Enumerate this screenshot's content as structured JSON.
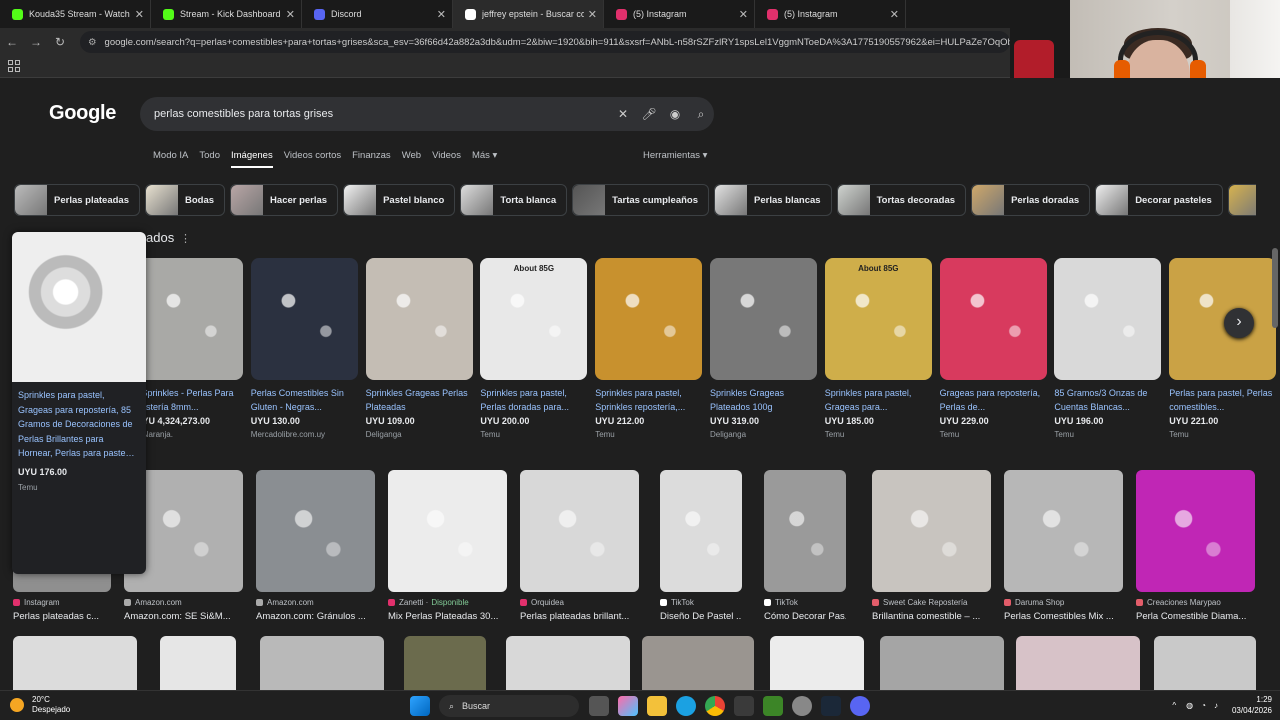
{
  "tabs": [
    {
      "title": "Kouda35 Stream - Watch Live",
      "color": "#53fc18"
    },
    {
      "title": "Stream - Kick Dashboard",
      "color": "#53fc18"
    },
    {
      "title": "Discord",
      "color": "#5865f2"
    },
    {
      "title": "jeffrey epstein - Buscar con G",
      "color": "#ffffff"
    },
    {
      "title": "(5) Instagram",
      "color": "#e1306c"
    },
    {
      "title": "(5) Instagram",
      "color": "#e1306c"
    }
  ],
  "address_url": "google.com/search?q=perlas+comestibles+para+tortas+grises&sca_esv=36f66d42a882a3db&udm=2&biw=1920&bih=911&sxsrf=ANbL-n58rSZFzlRY1spsLel1VggmNToeDA%3A1775190557962&ei=HULPaZe7OqOb5OU",
  "google_logo": "Google",
  "search_query": "perlas comestibles para tortas grises",
  "nav_tabs": [
    "Modo IA",
    "Todo",
    "Imágenes",
    "Videos cortos",
    "Finanzas",
    "Web",
    "Videos",
    "Más ▾"
  ],
  "tools_label": "Herramientas ▾",
  "chips": [
    "Perlas plateadas",
    "Bodas",
    "Hacer perlas",
    "Pastel blanco",
    "Torta blanca",
    "Tartas cumpleaños",
    "Perlas blancas",
    "Tortas decoradas",
    "Perlas doradas",
    "Decorar pasteles",
    "Per"
  ],
  "related_heading": "ados",
  "hover_card": {
    "title": "Sprinkles para pastel, Grageas para repostería, 85 Gramos de Decoraciones de Perlas Brillantes para Hornear, Perlas para paste…",
    "price": "UYU 176.00",
    "source": "Temu"
  },
  "products": [
    {
      "title": "- Sprinkles - Perlas Para postería 8mm...",
      "price": "UYU 4,324,273.00",
      "source": "a Naranja.",
      "bg": "#a9a9a6"
    },
    {
      "title": "Perlas Comestibles Sin Gluten - Negras...",
      "price": "UYU 130.00",
      "source": "Mercadolibre.com.uy",
      "bg": "#2b3140"
    },
    {
      "title": "Sprinkles Grageas Perlas Plateadas",
      "price": "UYU 109.00",
      "source": "Deliganga",
      "bg": "#c4bdb4"
    },
    {
      "title": "Sprinkles para pastel, Perlas doradas para...",
      "price": "UYU 200.00",
      "source": "Temu",
      "bg": "#e8e8e8",
      "label": "About 85G"
    },
    {
      "title": "Sprinkles para pastel, Sprinkles repostería,...",
      "price": "UYU 212.00",
      "source": "Temu",
      "bg": "#c8912e"
    },
    {
      "title": "Sprinkles Grageas Plateados 100g",
      "price": "UYU 319.00",
      "source": "Deliganga",
      "bg": "#787878"
    },
    {
      "title": "Sprinkles para pastel, Grageas para...",
      "price": "UYU 185.00",
      "source": "Temu",
      "bg": "#cfae4a",
      "label": "About 85G"
    },
    {
      "title": "Grageas para repostería, Perlas de...",
      "price": "UYU 229.00",
      "source": "Temu",
      "bg": "#d83a5e"
    },
    {
      "title": "85 Gramos/3 Onzas de Cuentas Blancas...",
      "price": "UYU 196.00",
      "source": "Temu",
      "bg": "#d9d9d9"
    },
    {
      "title": "Perlas para pastel, Perlas comestibles...",
      "price": "UYU 221.00",
      "source": "Temu",
      "bg": "#caa245"
    }
  ],
  "grid": [
    {
      "source": "Instagram",
      "title": "Perlas plateadas c...",
      "bg": "#8f8f8f",
      "icon": "#e1306c"
    },
    {
      "source": "Amazon.com",
      "title": "Amazon.com: SE Si&M...",
      "bg": "#b0b0b0",
      "icon": "#aaaaaa"
    },
    {
      "source": "Amazon.com",
      "title": "Amazon.com: Gránulos ...",
      "bg": "#8a8e92",
      "icon": "#aaaaaa"
    },
    {
      "source": "Zanetti · ",
      "available": "Disponible",
      "title": "Mix Perlas Plateadas 30...",
      "bg": "#ececec",
      "icon": "#e1306c"
    },
    {
      "source": "Orquidea",
      "title": "Perlas plateadas brillant...",
      "bg": "#d8d8d8",
      "icon": "#e1306c"
    },
    {
      "source": "TikTok",
      "title": "Diseño De Pastel ...",
      "bg": "#dcdcdc",
      "icon": "#ffffff"
    },
    {
      "source": "TikTok",
      "title": "Cómo Decorar Pas...",
      "bg": "#9a9a9a",
      "icon": "#ffffff"
    },
    {
      "source": "Sweet Cake Repostería",
      "title": "Brillantina comestible – ...",
      "bg": "#c8c4bf",
      "icon": "#e35d6a"
    },
    {
      "source": "Daruma Shop",
      "title": "Perlas Comestibles Mix ...",
      "bg": "#b7b7b7",
      "icon": "#e35d6a"
    },
    {
      "source": "Creaciones Marypao",
      "title": "Perla Comestible Diama...",
      "bg": "#c026b5",
      "icon": "#e35d6a"
    }
  ],
  "row3": [
    "#dcdcdc",
    "#e6e6e6",
    "#b9b9b9",
    "#6b6b4d",
    "#d8d8d8",
    "#9a9590",
    "#ececec",
    "#a5a5a5",
    "#d7c2c8",
    "#c9c9c9"
  ],
  "weather": {
    "temp": "20°C",
    "desc": "Despejado"
  },
  "taskbar_search": "Buscar",
  "clock": {
    "time": "1:29",
    "date": "03/04/2026"
  },
  "brand_colors": {
    "link": "#99c3ff",
    "bg": "#1f1f1f",
    "kick": "#53fc18"
  }
}
